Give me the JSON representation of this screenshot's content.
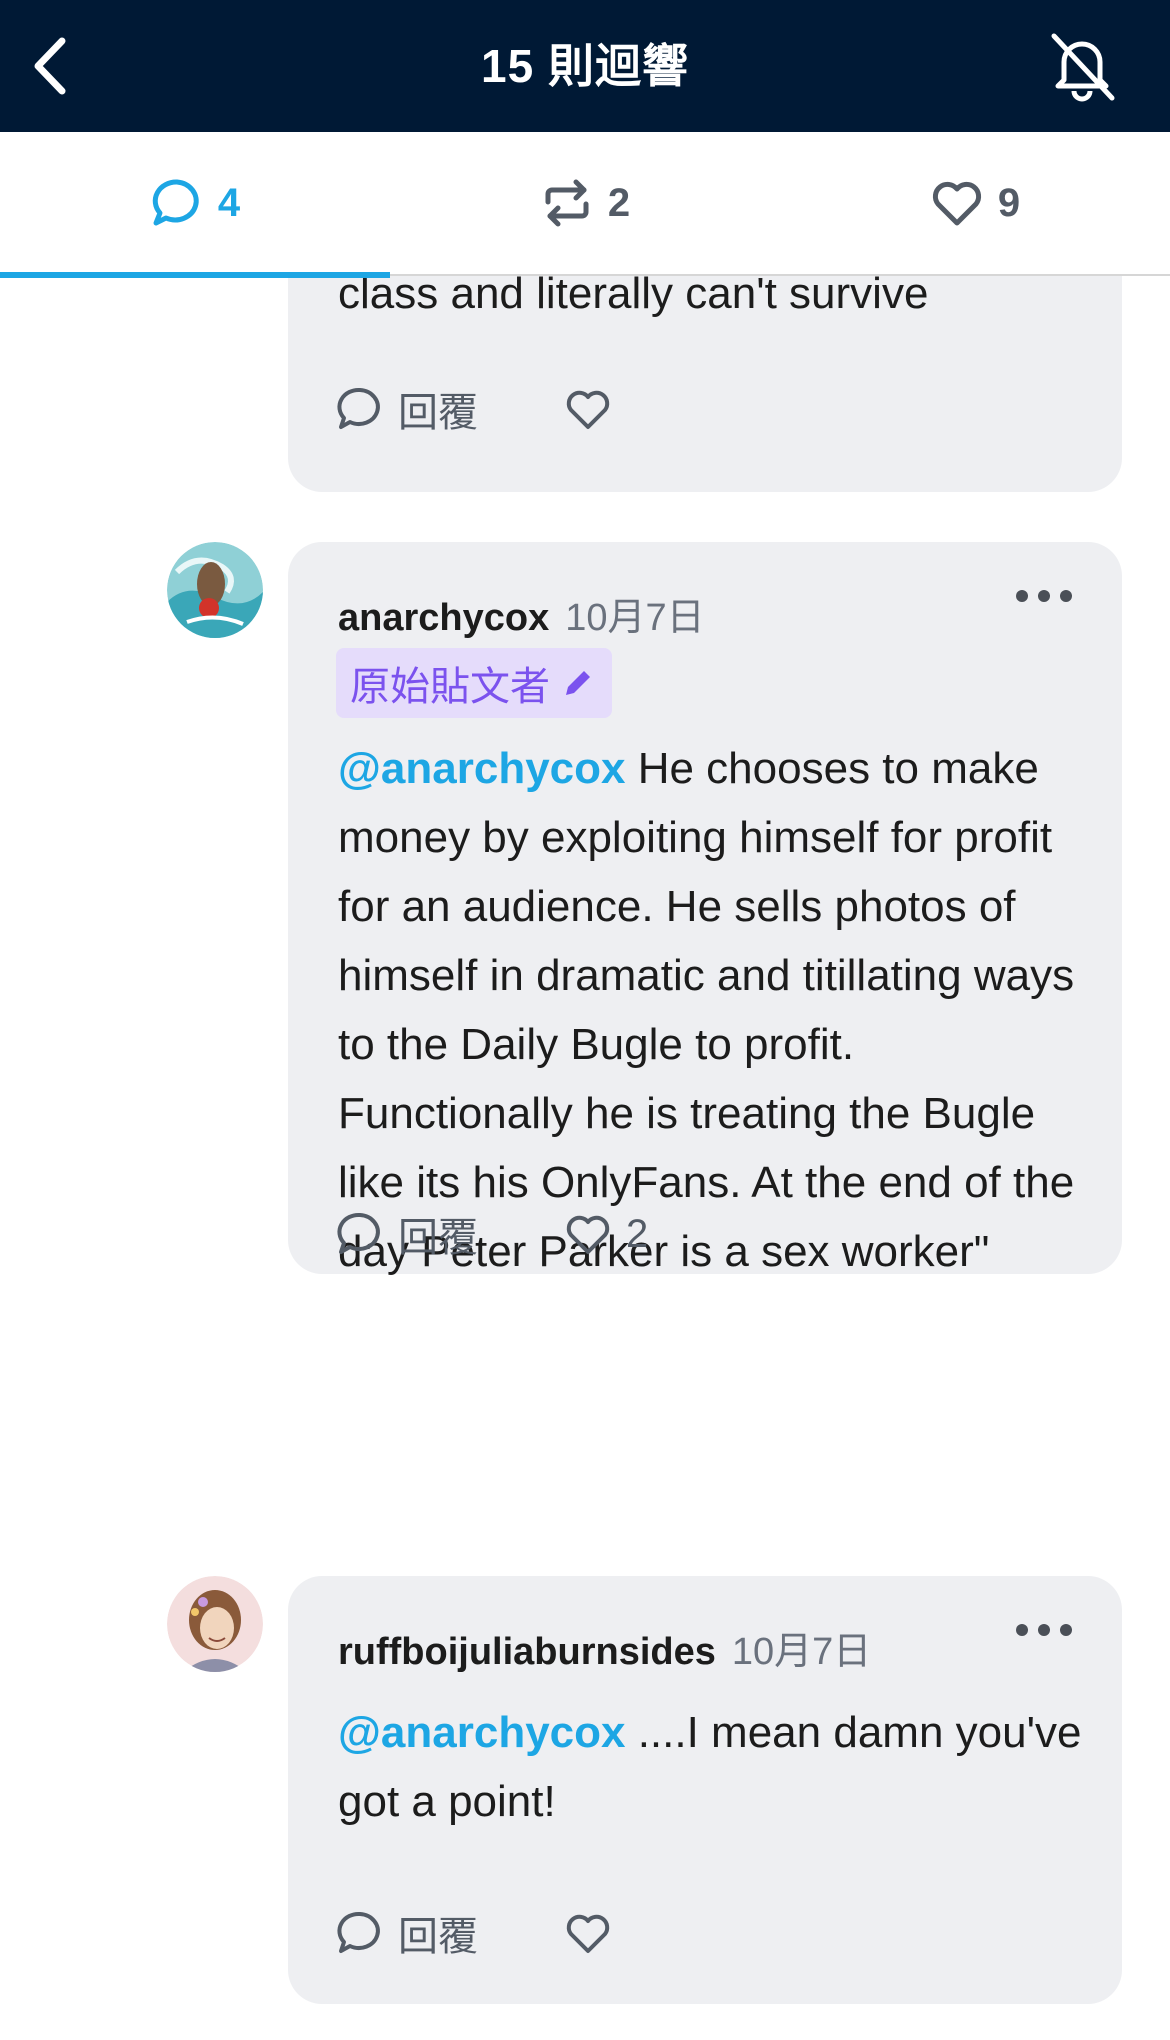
{
  "header": {
    "title": "15 則迴響",
    "back_icon": "chevron-left-icon",
    "bell_icon": "bell-off-icon"
  },
  "tabs": [
    {
      "icon": "comment-icon",
      "count": "4",
      "active": true
    },
    {
      "icon": "reblog-icon",
      "count": "2",
      "active": false
    },
    {
      "icon": "heart-icon",
      "count": "9",
      "active": false
    }
  ],
  "comments": [
    {
      "truncated_text": "class and literally can't survive",
      "reply_label": "回覆",
      "likes": ""
    },
    {
      "username": "anarchycox",
      "date": "10月7日",
      "badge": "原始貼文者",
      "mention": "@anarchycox",
      "text": " He chooses to make money by exploiting himself for profit for an audience. He sells photos of himself in dramatic and titillating ways to the Daily Bugle to profit. Functionally he is treating the Bugle like its his OnlyFans. At the end of the day Peter Parker is a sex worker\"",
      "reply_label": "回覆",
      "likes": "2"
    },
    {
      "username": "ruffboijuliaburnsides",
      "date": "10月7日",
      "mention": "@anarchycox",
      "text": " ....I mean damn you've got a point!",
      "reply_label": "回覆",
      "likes": ""
    }
  ],
  "colors": {
    "header_bg": "#001935",
    "accent": "#1da6e4",
    "card_bg": "#eeeff2",
    "badge_bg": "#e5dcfb",
    "badge_fg": "#7b52ee"
  }
}
